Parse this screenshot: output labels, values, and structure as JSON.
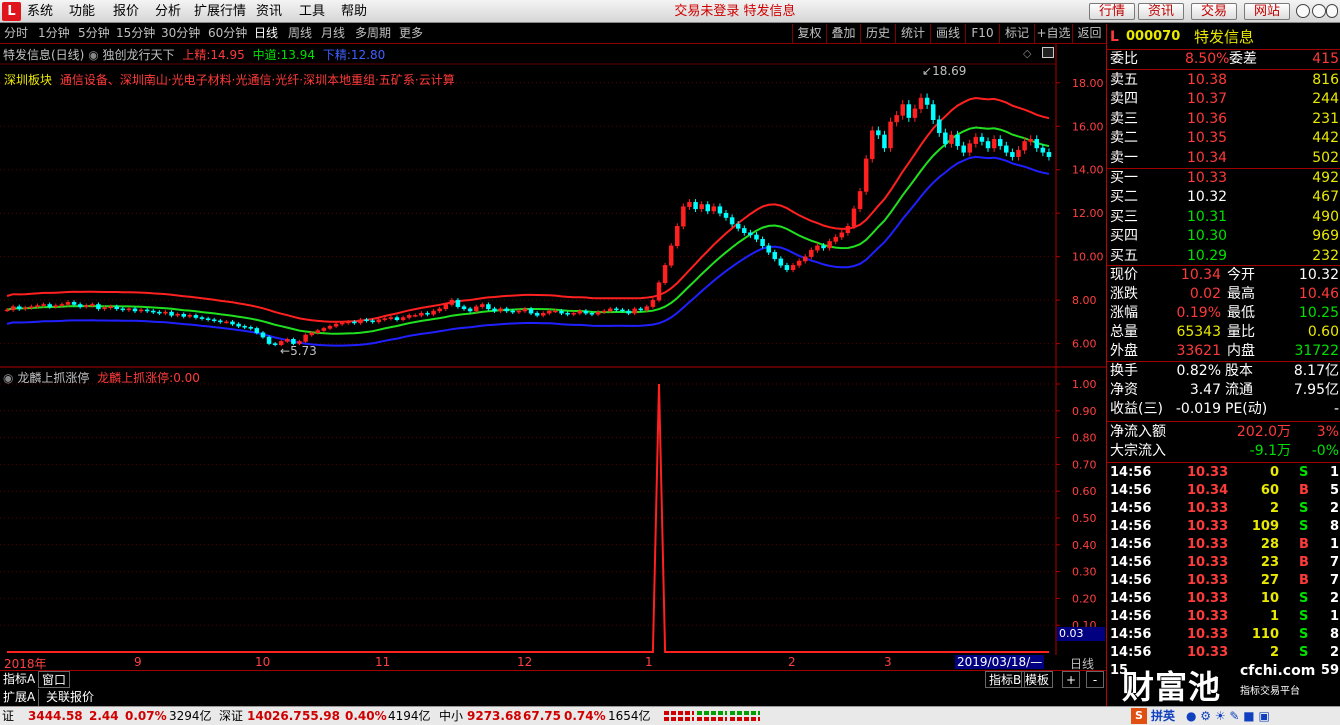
{
  "menubar": {
    "logo": "L",
    "items": [
      "系统",
      "功能",
      "报价",
      "分析",
      "扩展行情",
      "资讯",
      "工具",
      "帮助"
    ],
    "title": "交易未登录  特发信息",
    "buttons": [
      "行情",
      "资讯",
      "交易",
      "网站"
    ]
  },
  "toolbar": {
    "periods": [
      "分时",
      "1分钟",
      "5分钟",
      "15分钟",
      "30分钟",
      "60分钟",
      "日线",
      "周线",
      "月线",
      "多周期",
      "更多"
    ],
    "active_period": "日线",
    "buttons": [
      "复权",
      "叠加",
      "历史",
      "统计",
      "画线",
      "F10",
      "标记",
      "+自选",
      "返回"
    ]
  },
  "kline": {
    "title": "特发信息(日线)",
    "indicator": "独创龙行天下",
    "upper_label": "上精:",
    "upper_value": "14.95",
    "mid_label": "中道:",
    "mid_value": "13.94",
    "lower_label": "下精:",
    "lower_value": "12.80",
    "sector_label": "深圳板块",
    "sector_text": "通信设备、深圳南山·光电子材料·光通信·光纤·深圳本地重组·五矿系·云计算",
    "high_marker": "18.69",
    "low_marker": "5.73",
    "y_ticks": [
      "18.00",
      "16.00",
      "14.00",
      "12.00",
      "10.00",
      "8.00",
      "6.00"
    ],
    "y_values": [
      18,
      16,
      14,
      12,
      10,
      8,
      6
    ],
    "closes": [
      7.55,
      7.7,
      7.6,
      7.65,
      7.7,
      7.75,
      7.8,
      7.7,
      7.75,
      7.8,
      7.9,
      7.8,
      7.7,
      7.75,
      7.8,
      7.6,
      7.65,
      7.7,
      7.6,
      7.55,
      7.6,
      7.5,
      7.55,
      7.5,
      7.45,
      7.4,
      7.45,
      7.3,
      7.35,
      7.25,
      7.3,
      7.2,
      7.15,
      7.1,
      7.05,
      7.0,
      7.0,
      6.9,
      6.8,
      6.75,
      6.7,
      6.5,
      6.3,
      6.0,
      5.95,
      6.1,
      6.2,
      6.0,
      6.1,
      6.4,
      6.5,
      6.6,
      6.7,
      6.8,
      6.9,
      6.95,
      7.0,
      6.95,
      7.1,
      7.05,
      7.0,
      7.1,
      7.15,
      7.2,
      7.1,
      7.2,
      7.3,
      7.3,
      7.4,
      7.35,
      7.5,
      7.6,
      7.8,
      8.0,
      7.7,
      7.6,
      7.5,
      7.7,
      7.8,
      7.6,
      7.5,
      7.6,
      7.5,
      7.45,
      7.5,
      7.6,
      7.4,
      7.3,
      7.4,
      7.5,
      7.5,
      7.4,
      7.35,
      7.4,
      7.5,
      7.4,
      7.35,
      7.45,
      7.5,
      7.6,
      7.55,
      7.5,
      7.4,
      7.6,
      7.55,
      7.7,
      8.0,
      8.8,
      9.6,
      10.5,
      11.4,
      12.3,
      12.5,
      12.2,
      12.4,
      12.1,
      12.3,
      12.0,
      11.8,
      11.5,
      11.3,
      11.1,
      11.0,
      10.8,
      10.5,
      10.2,
      9.9,
      9.6,
      9.4,
      9.6,
      9.8,
      10.0,
      10.3,
      10.5,
      10.4,
      10.7,
      10.9,
      11.1,
      11.4,
      12.2,
      13.0,
      14.5,
      15.8,
      15.6,
      15.0,
      16.2,
      16.5,
      17.0,
      16.4,
      16.8,
      17.3,
      17.0,
      16.3,
      15.7,
      15.2,
      15.6,
      15.1,
      14.8,
      15.2,
      15.5,
      15.3,
      15.0,
      15.4,
      15.1,
      14.8,
      14.6,
      14.9,
      15.3,
      15.4,
      15.0,
      14.8,
      14.6
    ]
  },
  "indicator2": {
    "title": "龙麟上抓涨停",
    "label": "龙麟上抓涨停:",
    "value": "0.00",
    "y_ticks": [
      "1.00",
      "0.90",
      "0.80",
      "0.70",
      "0.60",
      "0.50",
      "0.40",
      "0.30",
      "0.20",
      "0.10"
    ],
    "y_values": [
      1.0,
      0.9,
      0.8,
      0.7,
      0.6,
      0.5,
      0.4,
      0.3,
      0.2,
      0.1
    ],
    "cursor_value": "0.03"
  },
  "x_axis": {
    "labels": [
      "2018年",
      "9",
      "10",
      "11",
      "12",
      "1",
      "2",
      "3"
    ],
    "cursor_date": "2019/03/18/—",
    "right_label": "日线"
  },
  "bottom_tabs": {
    "left": [
      "指标A",
      "窗口",
      "扩展A",
      "关联报价"
    ],
    "right": [
      "指标B",
      "模板",
      "+",
      "-"
    ]
  },
  "quote": {
    "code": "000070",
    "name": "特发信息",
    "prefix": "L",
    "weibi_label": "委比",
    "weibi": "8.50%",
    "weicha_label": "委差",
    "weicha": "415",
    "sells": [
      {
        "label": "卖五",
        "price": "10.38",
        "vol": "816"
      },
      {
        "label": "卖四",
        "price": "10.37",
        "vol": "244"
      },
      {
        "label": "卖三",
        "price": "10.36",
        "vol": "231"
      },
      {
        "label": "卖二",
        "price": "10.35",
        "vol": "442"
      },
      {
        "label": "卖一",
        "price": "10.34",
        "vol": "502"
      }
    ],
    "buys": [
      {
        "label": "买一",
        "price": "10.33",
        "vol": "492"
      },
      {
        "label": "买二",
        "price": "10.32",
        "vol": "467"
      },
      {
        "label": "买三",
        "price": "10.31",
        "vol": "490"
      },
      {
        "label": "买四",
        "price": "10.30",
        "vol": "969"
      },
      {
        "label": "买五",
        "price": "10.29",
        "vol": "232"
      }
    ],
    "stats": [
      {
        "l1": "现价",
        "v1": "10.34",
        "c1": "red",
        "l2": "今开",
        "v2": "10.32",
        "c2": "white"
      },
      {
        "l1": "涨跌",
        "v1": "0.02",
        "c1": "red",
        "l2": "最高",
        "v2": "10.46",
        "c2": "red"
      },
      {
        "l1": "涨幅",
        "v1": "0.19%",
        "c1": "red",
        "l2": "最低",
        "v2": "10.25",
        "c2": "green"
      },
      {
        "l1": "总量",
        "v1": "65343",
        "c1": "yellow",
        "l2": "量比",
        "v2": "0.60",
        "c2": "yellow"
      },
      {
        "l1": "外盘",
        "v1": "33621",
        "c1": "red",
        "l2": "内盘",
        "v2": "31722",
        "c2": "green"
      }
    ],
    "stats2": [
      {
        "l1": "换手",
        "v1": "0.82%",
        "l2": "股本",
        "v2": "8.17亿"
      },
      {
        "l1": "净资",
        "v1": "3.47",
        "l2": "流通",
        "v2": "7.95亿"
      },
      {
        "l1": "收益(三)",
        "v1": "-0.019",
        "l2": "PE(动)",
        "v2": "-"
      }
    ],
    "flow": [
      {
        "label": "净流入额",
        "value": "202.0万",
        "pct": "3%",
        "c": "red"
      },
      {
        "label": "大宗流入",
        "value": "-9.1万",
        "pct": "-0%",
        "c": "green"
      }
    ],
    "ticks": [
      {
        "t": "14:56",
        "p": "10.33",
        "v": "0",
        "d": "S",
        "n": "1"
      },
      {
        "t": "14:56",
        "p": "10.34",
        "v": "60",
        "d": "B",
        "n": "5"
      },
      {
        "t": "14:56",
        "p": "10.33",
        "v": "2",
        "d": "S",
        "n": "2"
      },
      {
        "t": "14:56",
        "p": "10.33",
        "v": "109",
        "d": "S",
        "n": "8"
      },
      {
        "t": "14:56",
        "p": "10.33",
        "v": "28",
        "d": "B",
        "n": "1"
      },
      {
        "t": "14:56",
        "p": "10.33",
        "v": "23",
        "d": "B",
        "n": "7"
      },
      {
        "t": "14:56",
        "p": "10.33",
        "v": "27",
        "d": "B",
        "n": "7"
      },
      {
        "t": "14:56",
        "p": "10.33",
        "v": "10",
        "d": "S",
        "n": "2"
      },
      {
        "t": "14:56",
        "p": "10.33",
        "v": "1",
        "d": "S",
        "n": "1"
      },
      {
        "t": "14:56",
        "p": "10.33",
        "v": "110",
        "d": "S",
        "n": "8"
      },
      {
        "t": "14:56",
        "p": "10.33",
        "v": "2",
        "d": "S",
        "n": "2"
      },
      {
        "t": "15",
        "p": "",
        "v": "",
        "d": "",
        "n": "59"
      }
    ]
  },
  "statusbar": {
    "items": [
      {
        "name": "上证",
        "price": "3444.58",
        "chg": "2.44",
        "pct": "0.07%",
        "amt": "3294亿"
      },
      {
        "name": "深证",
        "price": "14026.7",
        "chg": "55.98",
        "pct": "0.40%",
        "amt": "4194亿"
      },
      {
        "name": "中小",
        "price": "9273.68",
        "chg": "67.75",
        "pct": "0.74%",
        "amt": "1654亿"
      }
    ],
    "first_prefix": "证",
    "ime": "拼英"
  },
  "watermark": {
    "brand": "财富池",
    "site": "cfchi.com",
    "sub": "指标交易平台"
  },
  "colors": {
    "up": "#ff2020",
    "down": "#00ffff",
    "upper_band": "#ff2020",
    "mid_band": "#20e020",
    "lower_band": "#2020ff",
    "grid": "#8b0000"
  }
}
